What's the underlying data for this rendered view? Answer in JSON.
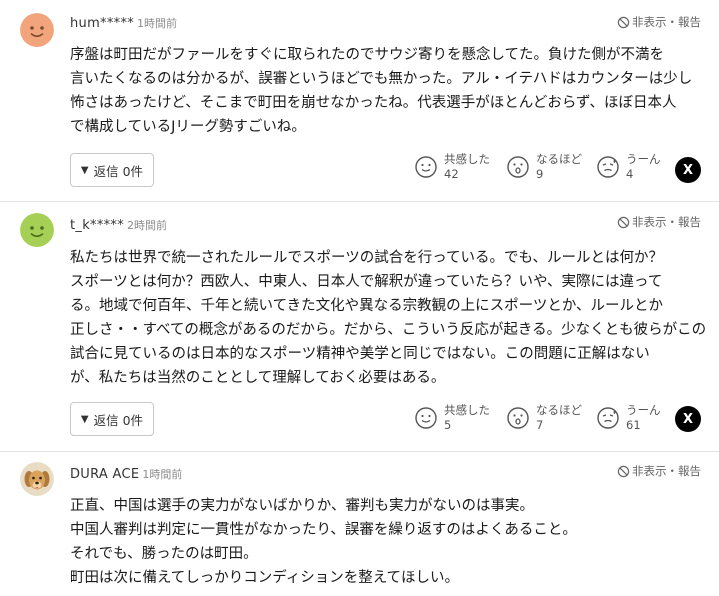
{
  "comments": [
    {
      "user": "hum*****",
      "time": "1時間前",
      "report": "非表示・報告",
      "lines": [
        "序盤は町田だがファールをすぐに取られたのでサウジ寄りを懸念してた。負けた側が不満を",
        "言いたくなるのは分かるが、誤審というほどでも無かった。アル・イテハドはカウンターは少し",
        "怖さはあったけど、そこまで町田を崩せなかったね。代表選手がほとんどおらず、ほぼ日本人",
        "で構成しているJリーグ勢すごいね。"
      ],
      "reply_label": "返信 0件",
      "reactions": [
        {
          "label": "共感した",
          "count": "42"
        },
        {
          "label": "なるほど",
          "count": "9"
        },
        {
          "label": "うーん",
          "count": "4"
        }
      ],
      "x_label": "X"
    },
    {
      "user": "t_k*****",
      "time": "2時間前",
      "report": "非表示・報告",
      "lines": [
        "私たちは世界で統一されたルールでスポーツの試合を行っている。でも、ルールとは何か？",
        "スポーツとは何か？西欧人、中東人、日本人で解釈が違っていたら？いや、実際には違って",
        "る。地域で何百年、千年と続いてきた文化や異なる宗教観の上にスポーツとか、ルールとか",
        "正しさ・・すべての概念があるのだから。だから、こういう反応が起きる。少なくとも彼らがこの",
        "試合に見ているのは日本的なスポーツ精神や美学と同じではない。この問題に正解はない",
        "が、私たちは当然のこととして理解しておく必要はある。"
      ],
      "reply_label": "返信 0件",
      "reactions": [
        {
          "label": "共感した",
          "count": "5"
        },
        {
          "label": "なるほど",
          "count": "7"
        },
        {
          "label": "うーん",
          "count": "61"
        }
      ],
      "x_label": "X"
    },
    {
      "user": "DURA ACE",
      "time": "1時間前",
      "report": "非表示・報告",
      "lines": [
        "正直、中国は選手の実力がないばかりか、審判も実力がないのは事実。",
        "中国人審判は判定に一貫性がなかったり、誤審を繰り返すのはよくあること。",
        "それでも、勝ったのは町田。",
        "町田は次に備えてしっかりコンディションを整えてほしい。"
      ]
    }
  ],
  "colors": {
    "avatar1": "#f2a57c",
    "avatar2": "#a6cf55",
    "divider": "#e4e4e4"
  },
  "icons": {
    "report": "ban-icon",
    "reply": "triangle-down-icon",
    "reaction1": "smile-face-icon",
    "reaction2": "surprised-face-icon",
    "reaction3": "sweat-face-icon",
    "share": "x-logo-icon"
  }
}
